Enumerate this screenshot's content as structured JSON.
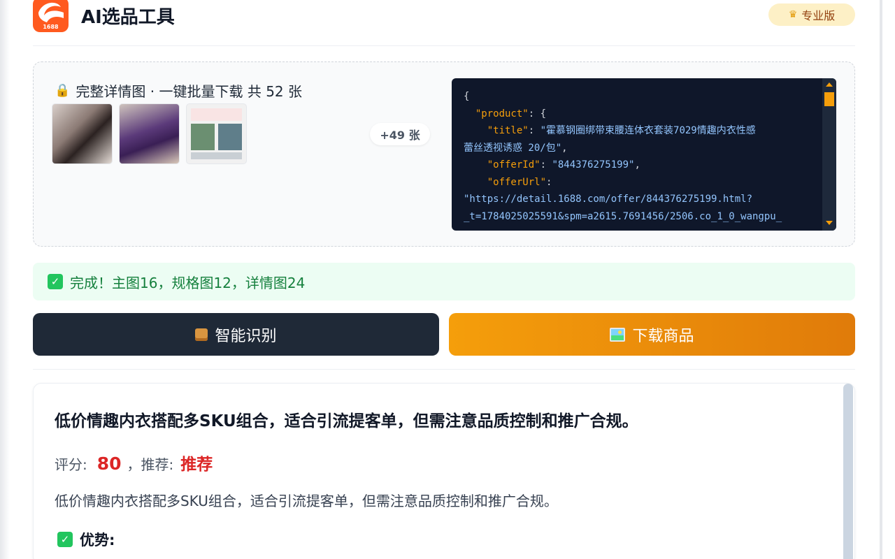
{
  "header": {
    "app_title": "AI选品工具",
    "logo_text": "1688",
    "pro_label": "专业版"
  },
  "preview": {
    "heading": "完整详情图 · 一键批量下载 共 52 张",
    "more_label": "+49 张",
    "thumbnail_count_shown": 3
  },
  "json_preview": {
    "lines": [
      {
        "indent": 0,
        "parts": [
          {
            "t": "p",
            "v": "{"
          }
        ]
      },
      {
        "indent": 1,
        "parts": [
          {
            "t": "k",
            "v": "\"product\""
          },
          {
            "t": "p",
            "v": ": {"
          }
        ]
      },
      {
        "indent": 2,
        "parts": [
          {
            "t": "k",
            "v": "\"title\""
          },
          {
            "t": "p",
            "v": ": "
          },
          {
            "t": "s",
            "v": "\"霍慕钢圈绑带束腰连体衣套装7029情趣内衣性感"
          }
        ]
      },
      {
        "indent": 0,
        "parts": [
          {
            "t": "s",
            "v": "蕾丝透视诱惑 20/包\""
          },
          {
            "t": "p",
            "v": ","
          }
        ]
      },
      {
        "indent": 2,
        "parts": [
          {
            "t": "k",
            "v": "\"offerId\""
          },
          {
            "t": "p",
            "v": ": "
          },
          {
            "t": "s",
            "v": "\"844376275199\""
          },
          {
            "t": "p",
            "v": ","
          }
        ]
      },
      {
        "indent": 2,
        "parts": [
          {
            "t": "k",
            "v": "\"offerUrl\""
          },
          {
            "t": "p",
            "v": ":"
          }
        ]
      },
      {
        "indent": 0,
        "parts": [
          {
            "t": "s",
            "v": "\"https://detail.1688.com/offer/844376275199.html?"
          }
        ]
      },
      {
        "indent": 0,
        "parts": [
          {
            "t": "s",
            "v": "_t=1784025025591&spm=a2615.7691456/2506.co_1_0_wangpu_"
          }
        ]
      }
    ]
  },
  "status": {
    "message": "完成！主图16，规格图12，详情图24"
  },
  "actions": {
    "identify_label": "智能识别",
    "download_label": "下载商品"
  },
  "analysis": {
    "title": "低价情趣内衣搭配多SKU组合，适合引流提客单，但需注意品质控制和推广合规。",
    "score_label": "评分:",
    "score_value": "80",
    "rec_label": "，推荐:",
    "rec_value": "推荐",
    "summary": "低价情趣内衣搭配多SKU组合，适合引流提客单，但需注意品质控制和推广合规。",
    "pros_label": "优势:"
  },
  "colors": {
    "accent_orange": "#f59e0b",
    "dark_button": "#1f2937",
    "success_green": "#15803d",
    "score_red": "#dc2626"
  }
}
